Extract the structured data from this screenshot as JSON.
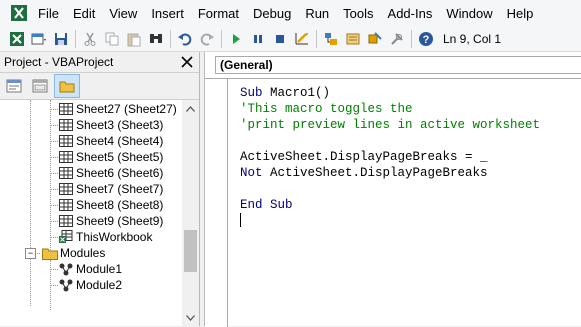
{
  "menu": [
    "File",
    "Edit",
    "View",
    "Insert",
    "Format",
    "Debug",
    "Run",
    "Tools",
    "Add-Ins",
    "Window",
    "Help"
  ],
  "status": {
    "position": "Ln 9, Col 1"
  },
  "project": {
    "title": "Project - VBAProject",
    "tree": [
      {
        "label": "Sheet27 (Sheet27)",
        "kind": "sheet"
      },
      {
        "label": "Sheet3 (Sheet3)",
        "kind": "sheet"
      },
      {
        "label": "Sheet4 (Sheet4)",
        "kind": "sheet"
      },
      {
        "label": "Sheet5 (Sheet5)",
        "kind": "sheet"
      },
      {
        "label": "Sheet6 (Sheet6)",
        "kind": "sheet"
      },
      {
        "label": "Sheet7 (Sheet7)",
        "kind": "sheet"
      },
      {
        "label": "Sheet8 (Sheet8)",
        "kind": "sheet"
      },
      {
        "label": "Sheet9 (Sheet9)",
        "kind": "sheet"
      },
      {
        "label": "ThisWorkbook",
        "kind": "workbook"
      },
      {
        "label": "Modules",
        "kind": "folder"
      },
      {
        "label": "Module1",
        "kind": "module"
      },
      {
        "label": "Module2",
        "kind": "module"
      }
    ],
    "expander": "−"
  },
  "code": {
    "object_combo": "(General)",
    "lines": [
      {
        "parts": [
          {
            "t": "Sub ",
            "c": "kw"
          },
          {
            "t": "Macro1()",
            "c": ""
          }
        ]
      },
      {
        "parts": [
          {
            "t": "'This macro toggles the",
            "c": "cm"
          }
        ]
      },
      {
        "parts": [
          {
            "t": "'print preview lines in active worksheet",
            "c": "cm"
          }
        ]
      },
      {
        "parts": [
          {
            "t": "",
            "c": ""
          }
        ]
      },
      {
        "parts": [
          {
            "t": "ActiveSheet.DisplayPageBreaks = _",
            "c": ""
          }
        ]
      },
      {
        "parts": [
          {
            "t": "Not ",
            "c": "kw"
          },
          {
            "t": "ActiveSheet.DisplayPageBreaks",
            "c": ""
          }
        ]
      },
      {
        "parts": [
          {
            "t": "",
            "c": ""
          }
        ]
      },
      {
        "parts": [
          {
            "t": "End Sub",
            "c": "kw"
          }
        ]
      }
    ]
  },
  "colors": {
    "keyword": "#000080",
    "comment": "#008000"
  }
}
